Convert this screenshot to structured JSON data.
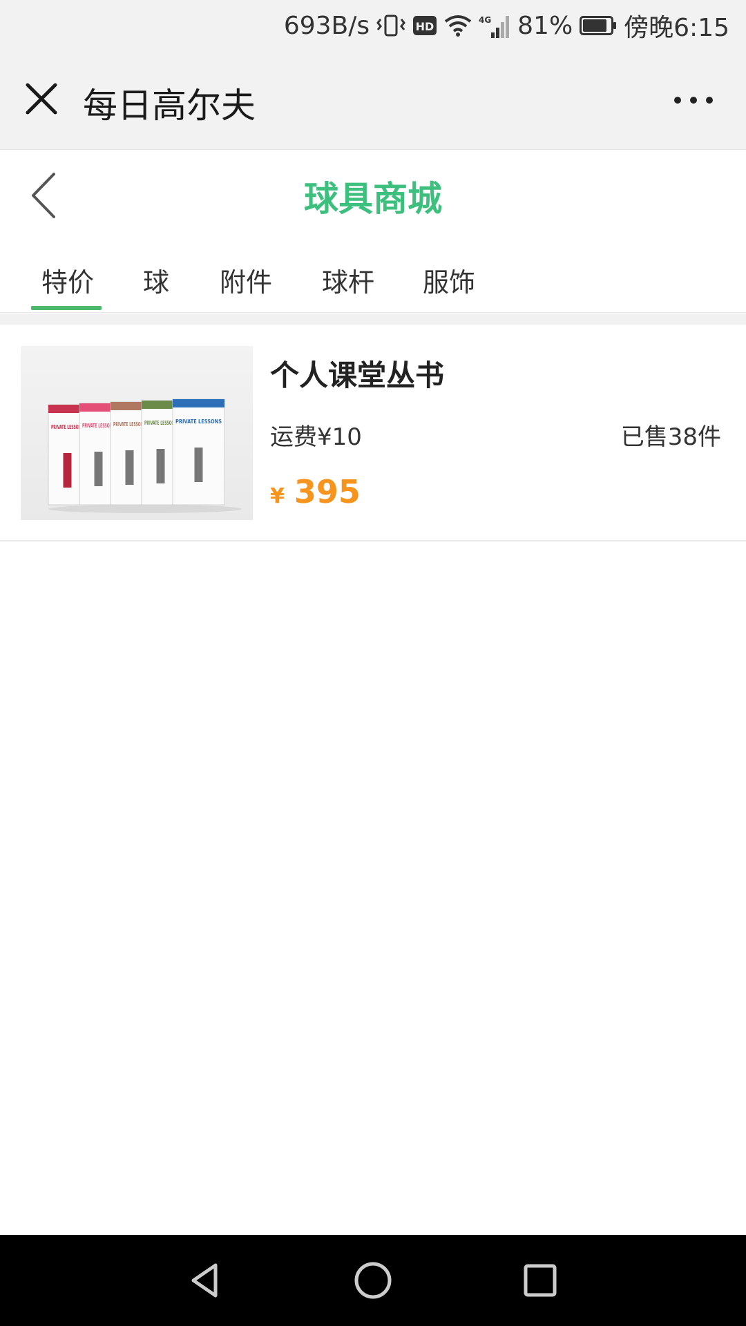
{
  "status_bar": {
    "speed": "693B/s",
    "network_label": "4G",
    "hd_label": "HD",
    "battery": "81%",
    "time": "傍晚6:15"
  },
  "wx_bar": {
    "title": "每日高尔夫"
  },
  "page": {
    "title": "球具商城"
  },
  "tabs": [
    {
      "label": "特价",
      "active": true
    },
    {
      "label": "球",
      "active": false
    },
    {
      "label": "附件",
      "active": false
    },
    {
      "label": "球杆",
      "active": false
    },
    {
      "label": "服饰",
      "active": false
    }
  ],
  "product": {
    "title": "个人课堂丛书",
    "shipping": "运费¥10",
    "sold": "已售38件",
    "currency": "¥",
    "price": "395",
    "book_label": "PRIVATE LESSONS",
    "book_colors": [
      "#c8334f",
      "#e34f77",
      "#b07860",
      "#6c8a48",
      "#2d6fb6"
    ]
  },
  "colors": {
    "accent_green": "#3dbf7d",
    "tab_underline": "#4cb86b",
    "price_orange": "#f7941d"
  }
}
